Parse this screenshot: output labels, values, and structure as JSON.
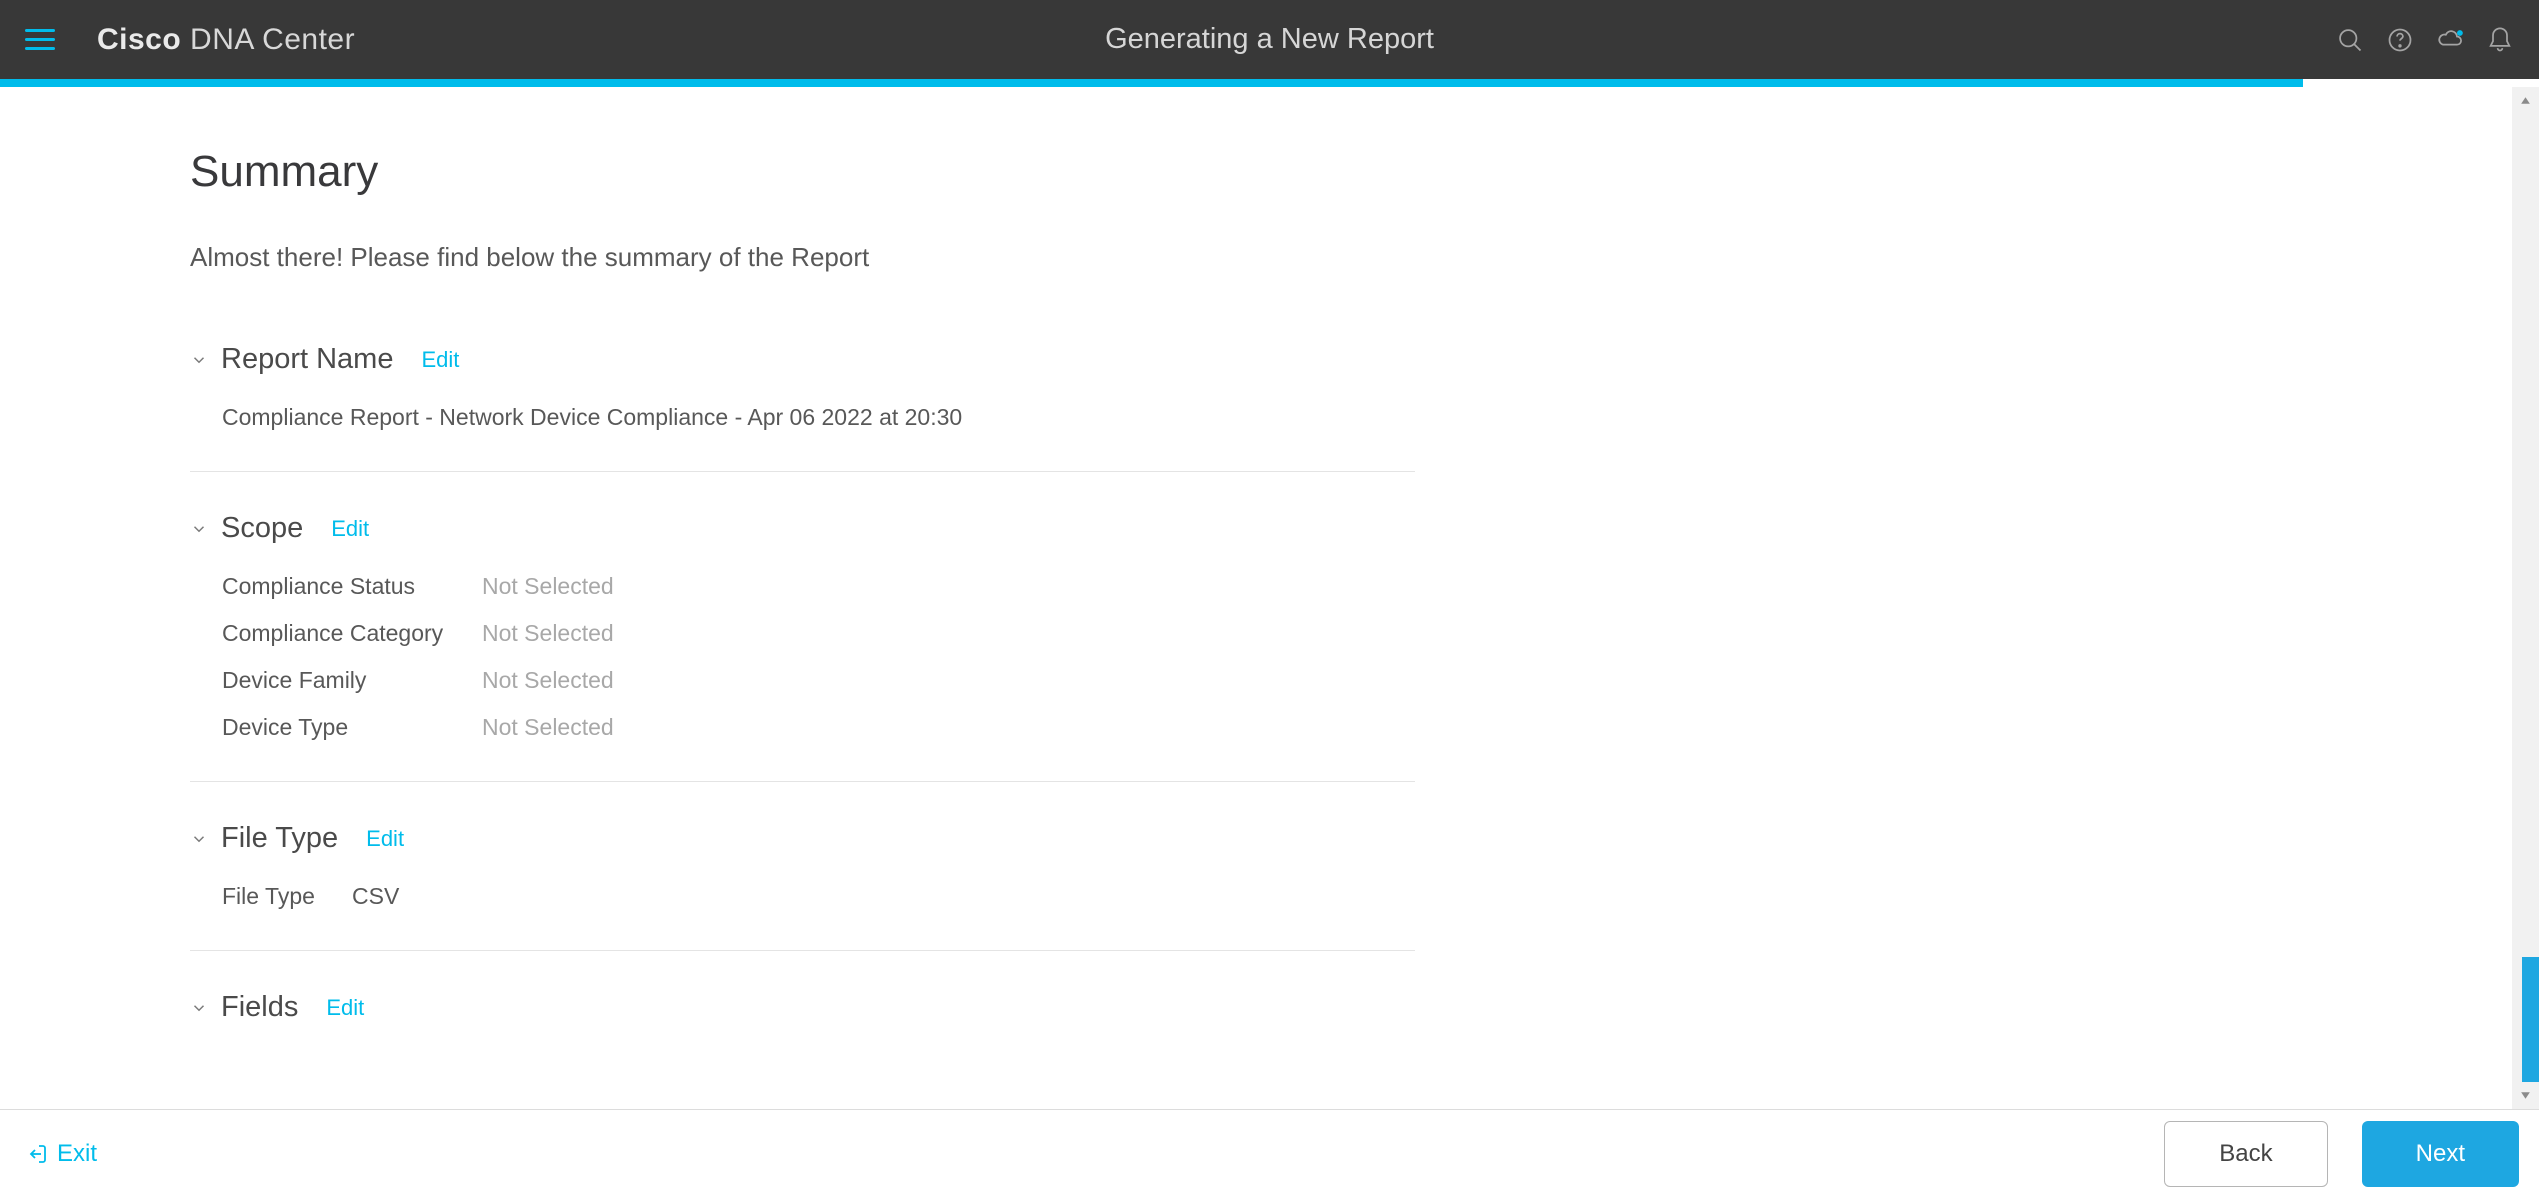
{
  "header": {
    "brand": "Cisco",
    "product": "DNA Center",
    "page_title": "Generating a New Report"
  },
  "progress": {
    "percent": 90.7
  },
  "summary": {
    "title": "Summary",
    "subtitle": "Almost there! Please find below the summary of the Report"
  },
  "sections": {
    "report_name": {
      "title": "Report Name",
      "edit": "Edit",
      "value": "Compliance Report - Network Device Compliance - Apr 06 2022 at 20:30"
    },
    "scope": {
      "title": "Scope",
      "edit": "Edit",
      "fields": [
        {
          "label": "Compliance Status",
          "value": "Not Selected"
        },
        {
          "label": "Compliance Category",
          "value": "Not Selected"
        },
        {
          "label": "Device Family",
          "value": "Not Selected"
        },
        {
          "label": "Device Type",
          "value": "Not Selected"
        }
      ]
    },
    "file_type": {
      "title": "File Type",
      "edit": "Edit",
      "label": "File Type",
      "value": "CSV"
    },
    "fields": {
      "title": "Fields",
      "edit": "Edit"
    }
  },
  "footer": {
    "exit": "Exit",
    "back": "Back",
    "next": "Next"
  }
}
